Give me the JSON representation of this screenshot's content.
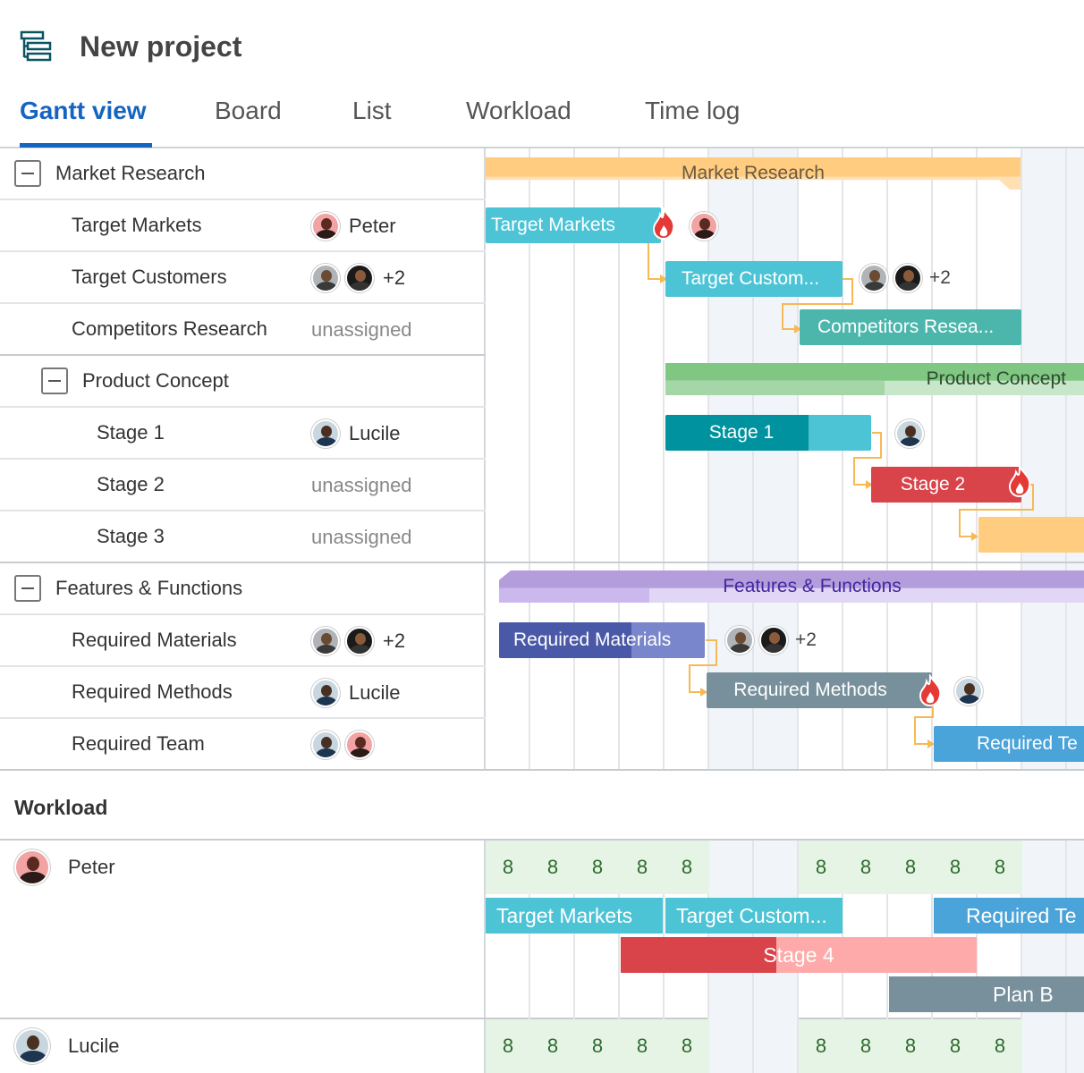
{
  "header": {
    "project_icon": "gantt-list-icon",
    "title": "New project"
  },
  "tabs": [
    {
      "label": "Gantt view",
      "active": true
    },
    {
      "label": "Board",
      "active": false
    },
    {
      "label": "List",
      "active": false
    },
    {
      "label": "Workload",
      "active": false
    },
    {
      "label": "Time log",
      "active": false
    }
  ],
  "tasks": [
    {
      "name": "Market Research",
      "type": "group",
      "assignee": ""
    },
    {
      "name": "Target Markets",
      "type": "task",
      "assignee": "Peter"
    },
    {
      "name": "Target Customers",
      "type": "task",
      "assignee": "+2"
    },
    {
      "name": "Competitors Research",
      "type": "task",
      "assignee": "unassigned"
    },
    {
      "name": "Product Concept",
      "type": "group",
      "assignee": ""
    },
    {
      "name": "Stage 1",
      "type": "task",
      "assignee": "Lucile"
    },
    {
      "name": "Stage 2",
      "type": "task",
      "assignee": "unassigned"
    },
    {
      "name": "Stage 3",
      "type": "task",
      "assignee": "unassigned"
    },
    {
      "name": "Features & Functions",
      "type": "group",
      "assignee": ""
    },
    {
      "name": "Required Materials",
      "type": "task",
      "assignee": "+2"
    },
    {
      "name": "Required Methods",
      "type": "task",
      "assignee": "Lucile"
    },
    {
      "name": "Required Team",
      "type": "task",
      "assignee": ""
    }
  ],
  "gantt_bars": {
    "market_research": "Market Research",
    "target_markets": "Target Markets",
    "target_customers": "Target Custom...",
    "competitors_research": "Competitors Resea...",
    "product_concept": "Product Concept",
    "stage1": "Stage 1",
    "stage2": "Stage 2",
    "features_functions": "Features & Functions",
    "required_materials": "Required Materials",
    "required_methods": "Required Methods",
    "required_team": "Required Te",
    "plus_count": "+2"
  },
  "workload": {
    "title": "Workload",
    "people": [
      {
        "name": "Peter",
        "hours": [
          "8",
          "8",
          "8",
          "8",
          "8",
          "",
          "",
          "8",
          "8",
          "8",
          "8",
          "8",
          ""
        ]
      },
      {
        "name": "Lucile",
        "hours": [
          "8",
          "8",
          "8",
          "8",
          "8",
          "",
          "",
          "8",
          "8",
          "8",
          "8",
          "8",
          ""
        ]
      }
    ],
    "bars": {
      "target_markets": "Target Markets",
      "target_customers": "Target Custom...",
      "required_team": "Required Te",
      "stage4": "Stage 4",
      "plan_b": "Plan B"
    }
  },
  "colors": {
    "accent": "#1565c0",
    "market_research": "#ffcc80",
    "target_markets": "#4dc3d6",
    "competitors": "#4db6ac",
    "product_concept": "#81c784",
    "stage1_dark": "#00939f",
    "stage2": "#d9434a",
    "features": "#b39ddb",
    "materials_dark": "#4a58a8",
    "methods": "#78909c",
    "required_team": "#4aa3d9",
    "workload_cell": "#e6f4e6"
  }
}
